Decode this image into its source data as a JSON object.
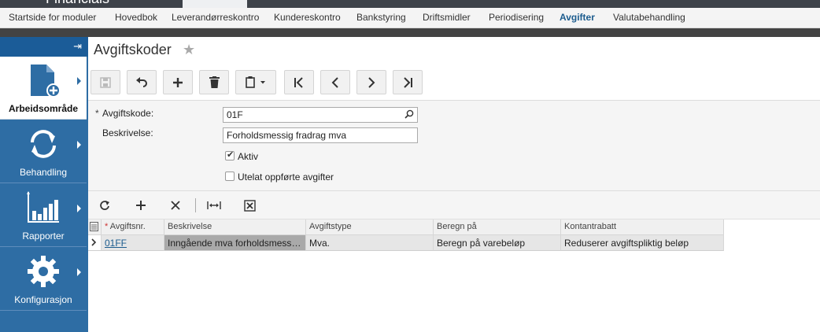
{
  "app": {
    "brand": "Financials"
  },
  "modules": [
    {
      "label": "Startside for moduler",
      "active": false
    },
    {
      "label": "Hovedbok",
      "active": false
    },
    {
      "label": "Leverandørreskontro",
      "active": false
    },
    {
      "label": "Kundereskontro",
      "active": false
    },
    {
      "label": "Bankstyring",
      "active": false
    },
    {
      "label": "Driftsmidler",
      "active": false
    },
    {
      "label": "Periodisering",
      "active": false
    },
    {
      "label": "Avgifter",
      "active": true
    },
    {
      "label": "Valutabehandling",
      "active": false
    }
  ],
  "sidebar": {
    "items": [
      {
        "label": "Arbeidsområde",
        "icon": "document-add-icon",
        "active": true
      },
      {
        "label": "Behandling",
        "icon": "refresh-cycle-icon",
        "active": false
      },
      {
        "label": "Rapporter",
        "icon": "bar-chart-icon",
        "active": false
      },
      {
        "label": "Konfigurasjon",
        "icon": "gear-icon",
        "active": false
      }
    ]
  },
  "page": {
    "title": "Avgiftskoder"
  },
  "toolbar": {
    "buttons": [
      "save-icon",
      "undo-icon",
      "plus-icon",
      "trash-icon",
      "clipboard-icon",
      "first-icon",
      "previous-icon",
      "next-icon",
      "last-icon"
    ]
  },
  "form": {
    "code_label": "Avgiftskode:",
    "code_required_mark": "*",
    "code_value": "01F",
    "desc_label": "Beskrivelse:",
    "desc_value": "Forholdsmessig fradrag mva",
    "active_label": "Aktiv",
    "active_checked": true,
    "exclude_label": "Utelat oppførte avgifter",
    "exclude_checked": false
  },
  "grid": {
    "columns": [
      "Avgiftsnr.",
      "Beskrivelse",
      "Avgiftstype",
      "Beregn på",
      "Kontantrabatt"
    ],
    "required_mark": "*",
    "rows": [
      [
        "01FF",
        "Inngående mva forholdsmessig fradrag",
        "Mva.",
        "Beregn på varebeløp",
        "Reduserer avgiftspliktig beløp"
      ]
    ]
  },
  "colors": {
    "accent": "#2e6da4",
    "active_module": "#1c5c8e",
    "topbar": "#3d4249"
  }
}
